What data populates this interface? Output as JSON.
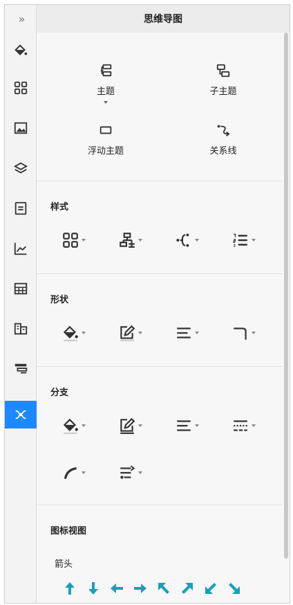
{
  "panel": {
    "title": "思维导图"
  },
  "rail": {
    "collapse_glyph": "»",
    "items": [
      {
        "name": "fill-icon"
      },
      {
        "name": "grid-icon"
      },
      {
        "name": "image-icon"
      },
      {
        "name": "layers-icon"
      },
      {
        "name": "document-icon"
      },
      {
        "name": "chart-icon"
      },
      {
        "name": "table-icon"
      },
      {
        "name": "org-icon"
      },
      {
        "name": "banner-icon"
      },
      {
        "name": "mindmap-icon",
        "active": true
      }
    ]
  },
  "topics": {
    "main": "主题",
    "sub": "子主题",
    "floating": "浮动主题",
    "relation": "关系线"
  },
  "style": {
    "title": "样式"
  },
  "shape": {
    "title": "形状"
  },
  "branch": {
    "title": "分支"
  },
  "iconview": {
    "title": "图标视图",
    "arrows_label": "箭头"
  },
  "colors": {
    "accent": "#1e88ff",
    "arrow": "#1aa0b8",
    "icon": "#333333"
  }
}
